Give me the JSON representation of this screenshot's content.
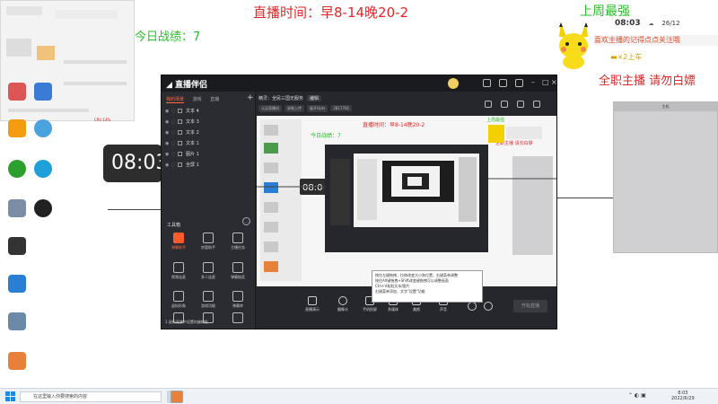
{
  "overlay": {
    "schedule": "直播时间：早8-14晚20-2",
    "record": "今日战绩：7",
    "last_week": "上周最强",
    "fulltime": "全职主播  请勿白嫖",
    "clock": "08:03",
    "clock_right": "08:03",
    "clock_date": "26/12",
    "banner": "喜欢主播的记得点点关注哦",
    "gold": "×2上车",
    "colors": {
      "red": "#e0282a",
      "green": "#28c028",
      "gold": "#d7a400"
    }
  },
  "desktop": {
    "icons": [
      {
        "label": "",
        "color": "#d55"
      },
      {
        "label": "",
        "color": "#3a7bd5"
      },
      {
        "label": "",
        "color": "#f39c12"
      },
      {
        "label": "",
        "color": "#4aa3df"
      },
      {
        "label": "",
        "color": "#2ca02c"
      },
      {
        "label": "",
        "color": "#1fa0d8"
      },
      {
        "label": "",
        "color": "#7a8fa6"
      },
      {
        "label": "",
        "color": "#222"
      },
      {
        "label": "",
        "color": "#333"
      },
      {
        "label": "",
        "color": "#2a7fd4"
      },
      {
        "label": "",
        "color": "#6c8aa8"
      },
      {
        "label": "",
        "color": "#e8803a"
      }
    ]
  },
  "app": {
    "tabs": [
      "我的场景",
      "游戏",
      "直播"
    ],
    "sources": [
      {
        "label": "文本 4"
      },
      {
        "label": "文本 3"
      },
      {
        "label": "文本 2"
      },
      {
        "label": "文本 1"
      },
      {
        "label": "图片 1"
      },
      {
        "label": "全屏 1"
      }
    ],
    "toolbox_title": "工具箱",
    "tools": [
      {
        "label": "弹幕助手",
        "hot": true
      },
      {
        "label": "房管助手",
        "hot": false
      },
      {
        "label": "主播任务",
        "hot": false
      },
      {
        "label": "视频连麦",
        "hot": false
      },
      {
        "label": "多人连麦",
        "hot": false
      },
      {
        "label": "弹幕抽奖",
        "hot": false
      },
      {
        "label": "虚拟形象",
        "hot": false
      },
      {
        "label": "游戏功能",
        "hot": false
      },
      {
        "label": "弹幕库",
        "hot": false
      },
      {
        "label": "",
        "hot": false
      },
      {
        "label": "",
        "hot": false
      },
      {
        "label": "",
        "hot": false
      }
    ],
    "bottom_note": "1.鼠标直播中设置的编辑框",
    "title_info": "精灵：全民三国无服务",
    "title_tag": "编辑",
    "sub_tags": [
      "认证直播间",
      "录制上传",
      "展开Opts",
      "2817781"
    ],
    "bottom_buttons": [
      "直播演示",
      "摄像头",
      "手机投屏",
      "多媒体",
      "美颜",
      "声音"
    ],
    "live_button": "开始直播",
    "tooltip_lines": [
      "按住左键拖拽，拉伸改变大小和位置，右键菜单调整",
      "按住Alt键拖拽+Shift改变键拖拽可以调整画面",
      "Ctrl+V粘贴文本/图片",
      "右键菜单添加、文字\"设置\"功能"
    ]
  },
  "right_panel": {
    "title": "主机",
    "lines": [
      "",
      "",
      "",
      "",
      ""
    ]
  },
  "taskbar": {
    "search_placeholder": "在这里输入你要搜索的内容",
    "time": "8:03",
    "date": "2022/6/29"
  }
}
